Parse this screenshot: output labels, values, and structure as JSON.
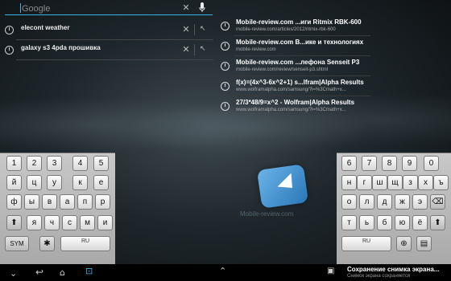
{
  "search": {
    "placeholder": "Google",
    "value": ""
  },
  "history": [
    {
      "text": "elecont weather"
    },
    {
      "text": "galaxy s3 4pda прошивка"
    }
  ],
  "suggestions": [
    {
      "title": "Mobile-review.com ...иги Ritmix RBK-600",
      "url": "mobile-review.com/articles/2012/ritmix-rbk-600"
    },
    {
      "title": "Mobile-review.com В...ике и технологиях",
      "url": "mobile-review.com"
    },
    {
      "title": "Mobile-review.com ...лефона Senseit P3",
      "url": "mobile-review.com/review/senseit-p3.shtml"
    },
    {
      "title": "f(x)=(4x^3-6x^2+1) s...lfram|Alpha Results",
      "url": "www.wolframalpha.com/samsung/?i=%3Cmath+x..."
    },
    {
      "title": "27/3*48/9=x^2 - Wolfram|Alpha Results",
      "url": "www.wolframalpha.com/samsung/?i=%3Cmath+x..."
    }
  ],
  "left_keyboard": {
    "row1": [
      "1",
      "2",
      "3",
      "4",
      "5"
    ],
    "row2": [
      "й",
      "ц",
      "у",
      "к",
      "е"
    ],
    "row3": [
      "ф",
      "ы",
      "в",
      "а",
      "п",
      "р"
    ],
    "row4": [
      "я",
      "ч",
      "с",
      "м",
      "и"
    ],
    "sym": "SYM",
    "lang": "RU"
  },
  "right_keyboard": {
    "row1": [
      "6",
      "7",
      "8",
      "9",
      "0"
    ],
    "row2": [
      "н",
      "г",
      "ш",
      "щ",
      "з",
      "х",
      "ъ"
    ],
    "row3": [
      "о",
      "л",
      "д",
      "ж",
      "э"
    ],
    "row4": [
      "т",
      "ь",
      "б",
      "ю",
      "ё"
    ],
    "lang": "RU"
  },
  "watermark": "Mobile-review.com",
  "notification": {
    "title": "Сохранение снимка экрана...",
    "subtitle": "Снимок экрана сохраняется"
  }
}
